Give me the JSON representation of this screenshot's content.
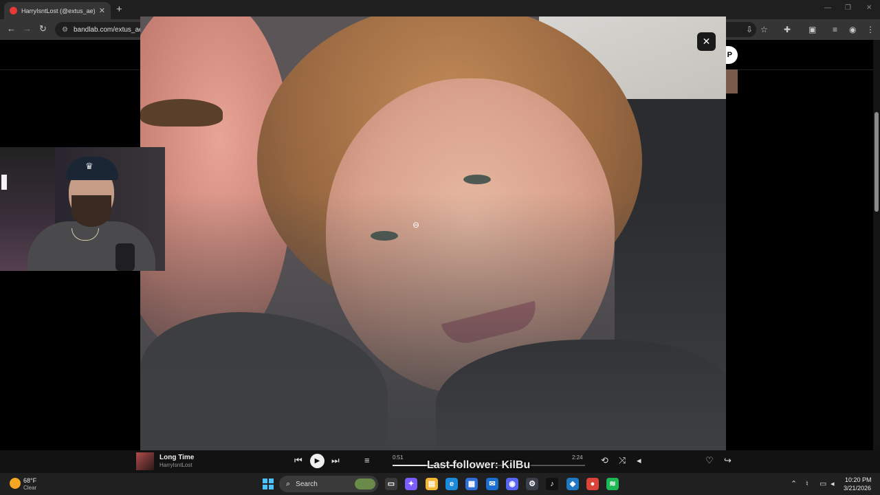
{
  "browser": {
    "tab_title": "HarryIsntLost (@extus_ae) • BandLab",
    "tab_close": "✕",
    "new_tab": "+",
    "url": "bandlab.com/extus_ae"
  },
  "page": {
    "top_right_pill_text": "P"
  },
  "lightbox": {
    "close_label": "✕"
  },
  "player": {
    "track_title": "Long Time",
    "artist": "HarryIsntLost",
    "current_time": "0:51",
    "duration": "2:24",
    "progress_fraction": 0.354
  },
  "stream_overlay": {
    "last_follower": "Last follower: KilBu"
  },
  "taskbar": {
    "weather_temp": "68°F",
    "weather_desc": "Clear",
    "search_label": "Search",
    "time": "10:20 PM",
    "date": "3/21/2026",
    "apps": [
      {
        "name": "task-view",
        "glyph": "▭",
        "color": "#3a3a3a"
      },
      {
        "name": "copilot",
        "glyph": "✦",
        "color": "#7b5cff"
      },
      {
        "name": "file-explorer",
        "glyph": "▤",
        "color": "#f2b632"
      },
      {
        "name": "edge",
        "glyph": "e",
        "color": "#1b8ad8"
      },
      {
        "name": "store",
        "glyph": "▦",
        "color": "#2f6fd6"
      },
      {
        "name": "outlook",
        "glyph": "✉",
        "color": "#1a6fd0"
      },
      {
        "name": "discord",
        "glyph": "◉",
        "color": "#5865f2"
      },
      {
        "name": "steam",
        "glyph": "⚙",
        "color": "#3a3f4a"
      },
      {
        "name": "tiktok",
        "glyph": "♪",
        "color": "#111111"
      },
      {
        "name": "vscode",
        "glyph": "◆",
        "color": "#1f78c1"
      },
      {
        "name": "chrome",
        "glyph": "●",
        "color": "#db4437"
      },
      {
        "name": "spotify",
        "glyph": "≋",
        "color": "#1db954"
      }
    ]
  }
}
